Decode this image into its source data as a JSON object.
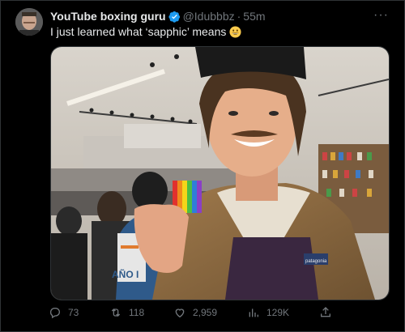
{
  "tweet": {
    "display_name": "YouTube boxing guru",
    "handle": "@Idubbbz",
    "separator": "·",
    "time": "55m",
    "text": "I just learned what ‘sapphic’ means",
    "emoji": "grinning-face-emoji",
    "more_label": "···"
  },
  "media": {
    "hoodie_text": "AÑO I",
    "patch_text": "patagonia"
  },
  "actions": {
    "replies": "73",
    "reposts": "118",
    "likes": "2,959",
    "views": "129K"
  },
  "colors": {
    "background": "#000000",
    "text": "#e7e9ea",
    "muted": "#71767b",
    "verified": "#1d9bf0",
    "border": "#2f3336"
  }
}
